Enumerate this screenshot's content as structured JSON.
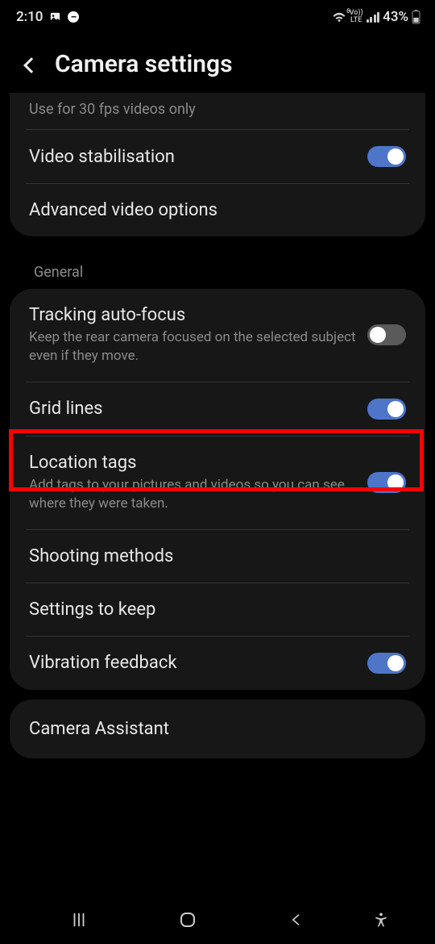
{
  "status": {
    "time": "2:10",
    "lte_label": "LTE",
    "vo_label": "Vo))",
    "battery_pct": "43%"
  },
  "header": {
    "title": "Camera settings"
  },
  "truncated": "Use for 30 fps videos only",
  "video": {
    "stabilisation": "Video stabilisation",
    "advanced": "Advanced video options"
  },
  "section": {
    "general": "General"
  },
  "general": {
    "tracking_title": "Tracking auto-focus",
    "tracking_sub": "Keep the rear camera focused on the selected subject even if they move.",
    "grid_title": "Grid lines",
    "location_title": "Location tags",
    "location_sub": "Add tags to your pictures and videos so you can see where they were taken.",
    "shooting": "Shooting methods",
    "settings_keep": "Settings to keep",
    "vibration": "Vibration feedback"
  },
  "assistant": "Camera Assistant"
}
